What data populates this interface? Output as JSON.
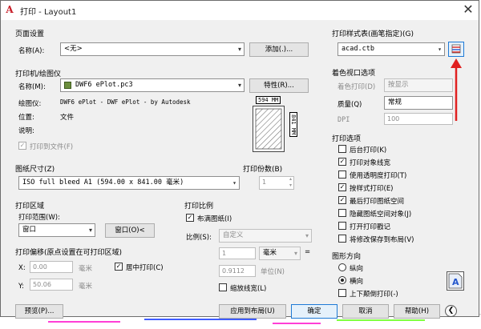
{
  "window": {
    "title": "打印 - Layout1"
  },
  "page_setup": {
    "group": "页面设置",
    "name_label": "名称(A):",
    "name_value": "<无>",
    "add_button": "添加(.)..."
  },
  "printer": {
    "group": "打印机/绘图仪",
    "name_label": "名称(M):",
    "name_value": "DWF6 ePlot.pc3",
    "properties_button": "特性(R)...",
    "plotter_label": "绘图仪:",
    "plotter_value": "DWF6 ePlot - DWF ePlot - by Autodesk",
    "location_label": "位置:",
    "location_value": "文件",
    "description_label": "说明:",
    "plot_to_file": "打印到文件(F)",
    "preview_width": "594 MM",
    "preview_height": "841 MM"
  },
  "paper_size": {
    "group": "图纸尺寸(Z)",
    "value": "ISO full bleed A1 (594.00 x 841.00 毫米)"
  },
  "copies": {
    "group": "打印份数(B)",
    "value": "1"
  },
  "plot_area": {
    "group": "打印区域",
    "range_label": "打印范围(W):",
    "range_value": "窗口",
    "window_button": "窗口(O)<"
  },
  "plot_offset": {
    "group": "打印偏移(原点设置在可打印区域)",
    "x_label": "X:",
    "x_value": "0.00",
    "x_unit": "毫米",
    "y_label": "Y:",
    "y_value": "50.06",
    "y_unit": "毫米",
    "center_plot": "居中打印(C)"
  },
  "plot_scale": {
    "group": "打印比例",
    "fit_to_paper": "布满图纸(I)",
    "scale_label": "比例(S):",
    "scale_value": "自定义",
    "value1": "1",
    "unit1": "毫米",
    "equals": "=",
    "value2": "0.9112",
    "unit2": "单位(N)",
    "scale_lineweights": "缩放线宽(L)"
  },
  "plot_style_table": {
    "group": "打印样式表(画笔指定)(G)",
    "value": "acad.ctb"
  },
  "shaded_viewport": {
    "group": "着色视口选项",
    "shade_label": "着色打印(D)",
    "shade_value": "按显示",
    "quality_label": "质量(Q)",
    "quality_value": "常规",
    "dpi_label": "DPI",
    "dpi_value": "100"
  },
  "plot_options": {
    "group": "打印选项",
    "items": [
      {
        "label": "后台打印(K)",
        "checked": ""
      },
      {
        "label": "打印对象线宽",
        "checked": "✓"
      },
      {
        "label": "使用透明度打印(T)",
        "checked": ""
      },
      {
        "label": "按样式打印(E)",
        "checked": "✓"
      },
      {
        "label": "最后打印图纸空间",
        "checked": "✓"
      },
      {
        "label": "隐藏图纸空间对象(J)",
        "checked": ""
      },
      {
        "label": "打开打印戳记",
        "checked": ""
      },
      {
        "label": "将修改保存到布局(V)",
        "checked": ""
      }
    ]
  },
  "orientation": {
    "group": "图形方向",
    "portrait": "纵向",
    "landscape": "横向",
    "upside_down": "上下颠倒打印(-)"
  },
  "footer": {
    "preview": "预览(P)...",
    "apply_layout": "应用到布局(U)",
    "ok": "确定",
    "cancel": "取消",
    "help": "帮助(H)"
  }
}
